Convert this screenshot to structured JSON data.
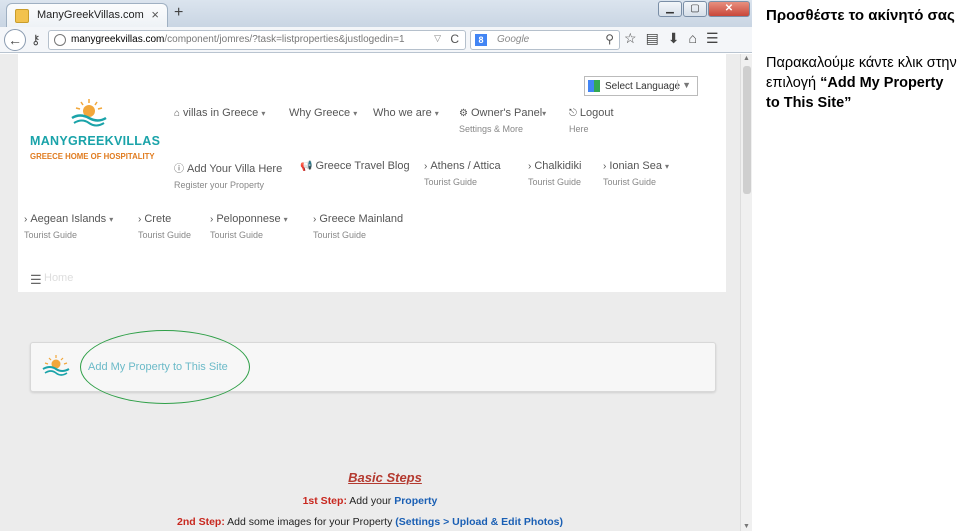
{
  "browser": {
    "tab_title": "ManyGreekVillas.com",
    "tab_close": "×",
    "new_tab": "+",
    "url_host": "manygreekvillas.com",
    "url_path": "/component/jomres/?task=listproperties&justlogedin=1",
    "search_placeholder": "Google",
    "search_engine": "8",
    "win_min": "▁",
    "win_max": "▢",
    "win_close": "✕"
  },
  "site": {
    "language_select": "Select Language",
    "brand": "MANYGREEKVILLAS",
    "tagline": "GREECE HOME OF HOSPITALITY",
    "nav": [
      {
        "label": "villas in Greece",
        "sub": ""
      },
      {
        "label": "Why Greece",
        "sub": ""
      },
      {
        "label": "Who we are",
        "sub": ""
      },
      {
        "label": "Owner's Panel",
        "sub": "Settings & More"
      },
      {
        "label": "Logout",
        "sub": "Here"
      },
      {
        "label": "Add Your Villa Here",
        "sub": "Register your Property"
      },
      {
        "label": "Greece Travel Blog",
        "sub": ""
      },
      {
        "label": "Athens / Attica",
        "sub": "Tourist Guide"
      },
      {
        "label": "Chalkidiki",
        "sub": "Tourist Guide"
      },
      {
        "label": "Ionian Sea",
        "sub": "Tourist Guide"
      },
      {
        "label": "Aegean Islands",
        "sub": "Tourist Guide"
      },
      {
        "label": "Crete",
        "sub": "Tourist Guide"
      },
      {
        "label": "Peloponnese",
        "sub": "Tourist Guide"
      },
      {
        "label": "Greece Mainland",
        "sub": "Tourist Guide"
      }
    ],
    "menu_home": "Home",
    "add_property_link": "Add My Property to This Site",
    "steps": {
      "heading_b": "B",
      "heading_rest": "asic Steps",
      "step1_label": "1st Step:",
      "step1_text": " Add your ",
      "step1_link": "Property",
      "step2_label": "2nd Step:",
      "step2_text": " Add some images for your Property ",
      "step2_link": "(Settings > Upload & Edit Photos)"
    }
  },
  "annotation": {
    "title": "Προσθέστε το ακίνητό σας",
    "body": "Παρακαλούμε κάντε κλικ στην επιλογή ",
    "highlight": "“Add My Property to This Site”"
  },
  "colors": {
    "teal": "#1aa3a9",
    "orange": "#e07b1f",
    "link": "#6bbac8",
    "ellipse": "#2e9f47"
  }
}
